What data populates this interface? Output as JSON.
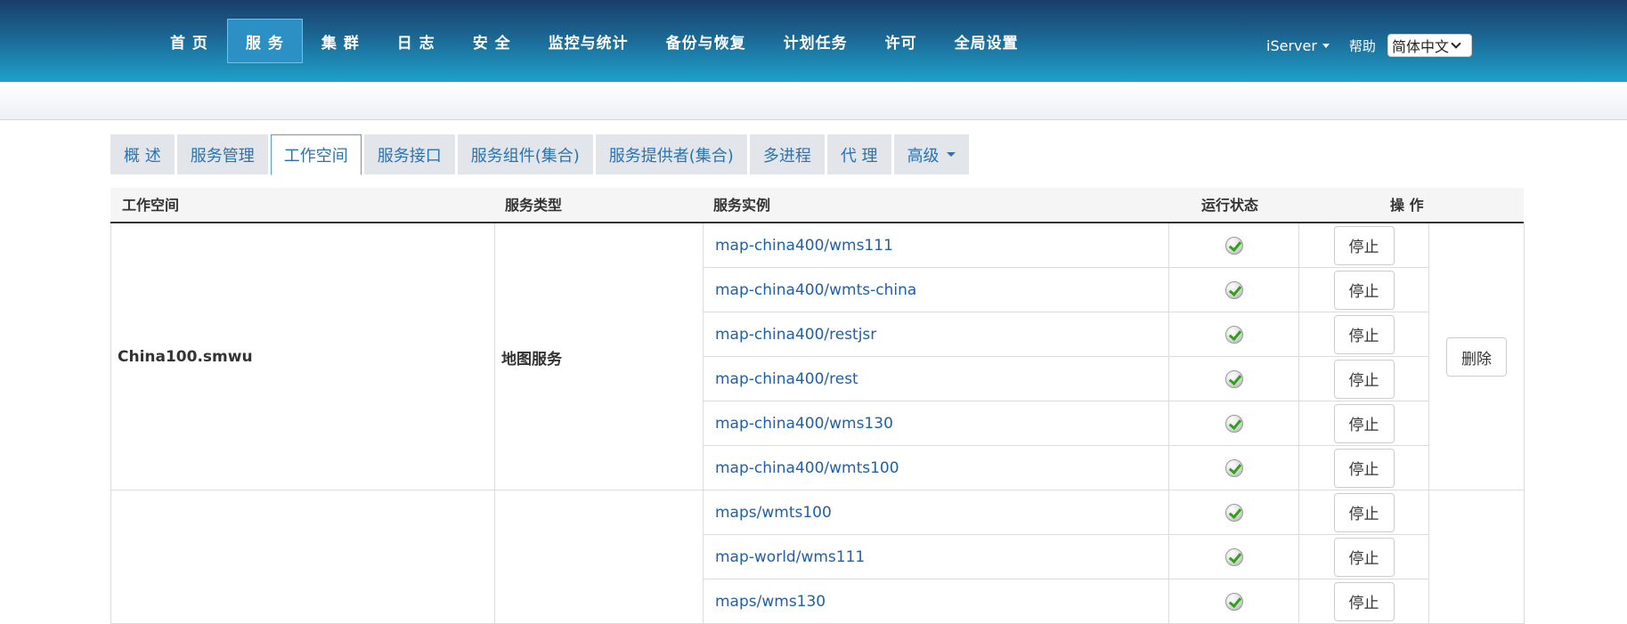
{
  "header": {
    "nav": [
      "首 页",
      "服 务",
      "集 群",
      "日 志",
      "安 全",
      "监控与统计",
      "备份与恢复",
      "计划任务",
      "许可",
      "全局设置"
    ],
    "active_nav": 1,
    "user": "iServer",
    "help": "帮助",
    "language": "简体中文"
  },
  "tabs": {
    "items": [
      "概 述",
      "服务管理",
      "工作空间",
      "服务接口",
      "服务组件(集合)",
      "服务提供者(集合)",
      "多进程",
      "代 理",
      "高级"
    ],
    "active": 2
  },
  "table": {
    "headers": {
      "workspace": "工作空间",
      "type": "服务类型",
      "instance": "服务实例",
      "status": "运行状态",
      "operation": "操 作"
    },
    "groups": [
      {
        "workspace": "China100.smwu",
        "type": "地图服务",
        "delete_label": "删除",
        "rows": [
          {
            "instance": "map-china400/wms111",
            "status": "running",
            "action": "停止"
          },
          {
            "instance": "map-china400/wmts-china",
            "status": "running",
            "action": "停止"
          },
          {
            "instance": "map-china400/restjsr",
            "status": "running",
            "action": "停止"
          },
          {
            "instance": "map-china400/rest",
            "status": "running",
            "action": "停止"
          },
          {
            "instance": "map-china400/wms130",
            "status": "running",
            "action": "停止"
          },
          {
            "instance": "map-china400/wmts100",
            "status": "running",
            "action": "停止"
          }
        ]
      },
      {
        "workspace": "",
        "type": "",
        "delete_label": "",
        "rows": [
          {
            "instance": "maps/wmts100",
            "status": "running",
            "action": "停止"
          },
          {
            "instance": "map-world/wms111",
            "status": "running",
            "action": "停止"
          },
          {
            "instance": "maps/wms130",
            "status": "running",
            "action": "停止"
          }
        ]
      }
    ]
  }
}
